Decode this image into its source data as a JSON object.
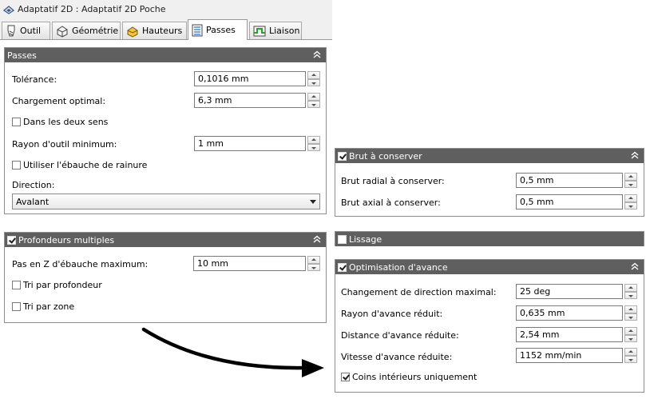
{
  "window": {
    "title": "Adaptatif 2D : Adaptatif 2D Poche"
  },
  "tabs": [
    {
      "label": "Outil"
    },
    {
      "label": "Géométrie"
    },
    {
      "label": "Hauteurs"
    },
    {
      "label": "Passes",
      "active": true
    },
    {
      "label": "Liaison"
    }
  ],
  "passes": {
    "title": "Passes",
    "tolerance_label": "Tolérance:",
    "tolerance_value": "0,1016 mm",
    "stepover_label": "Chargement optimal:",
    "stepover_value": "6,3 mm",
    "both_ways_label": "Dans les deux sens",
    "both_ways_checked": false,
    "min_radius_label": "Rayon d'outil minimum:",
    "min_radius_value": "1 mm",
    "slot_label": "Utiliser l'ébauche de rainure",
    "slot_checked": false,
    "direction_label": "Direction:",
    "direction_value": "Avalant"
  },
  "multiple_depths": {
    "title": "Profondeurs multiples",
    "checked": true,
    "max_step_label": "Pas en Z d'ébauche maximum:",
    "max_step_value": "10 mm",
    "order_depth_label": "Tri par profondeur",
    "order_depth_checked": false,
    "order_zone_label": "Tri par zone",
    "order_zone_checked": false
  },
  "stock_to_leave": {
    "title": "Brut à conserver",
    "checked": true,
    "radial_label": "Brut radial à conserver:",
    "radial_value": "0,5 mm",
    "axial_label": "Brut axial à conserver:",
    "axial_value": "0,5 mm"
  },
  "smoothing": {
    "title": "Lissage",
    "checked": false
  },
  "feed_optimization": {
    "title": "Optimisation d'avance",
    "checked": true,
    "direction_change_label": "Changement de direction maximal:",
    "direction_change_value": "25 deg",
    "reduced_radius_label": "Rayon d'avance réduit:",
    "reduced_radius_value": "0,635 mm",
    "reduced_distance_label": "Distance d'avance réduite:",
    "reduced_distance_value": "2,54 mm",
    "reduced_feed_label": "Vitesse d'avance réduite:",
    "reduced_feed_value": "1152 mm/min",
    "inner_corners_label": "Coins intérieurs uniquement",
    "inner_corners_checked": true
  },
  "colors": {
    "panel_header": "#5f5f5f",
    "tab_strip": "#f0f0f0",
    "arrow": "#000000"
  },
  "icons": [
    "app-icon",
    "tool-icon",
    "geometry-icon",
    "heights-icon",
    "passes-icon",
    "linking-icon",
    "collapse-chevron-icon",
    "arrow-icon"
  ]
}
